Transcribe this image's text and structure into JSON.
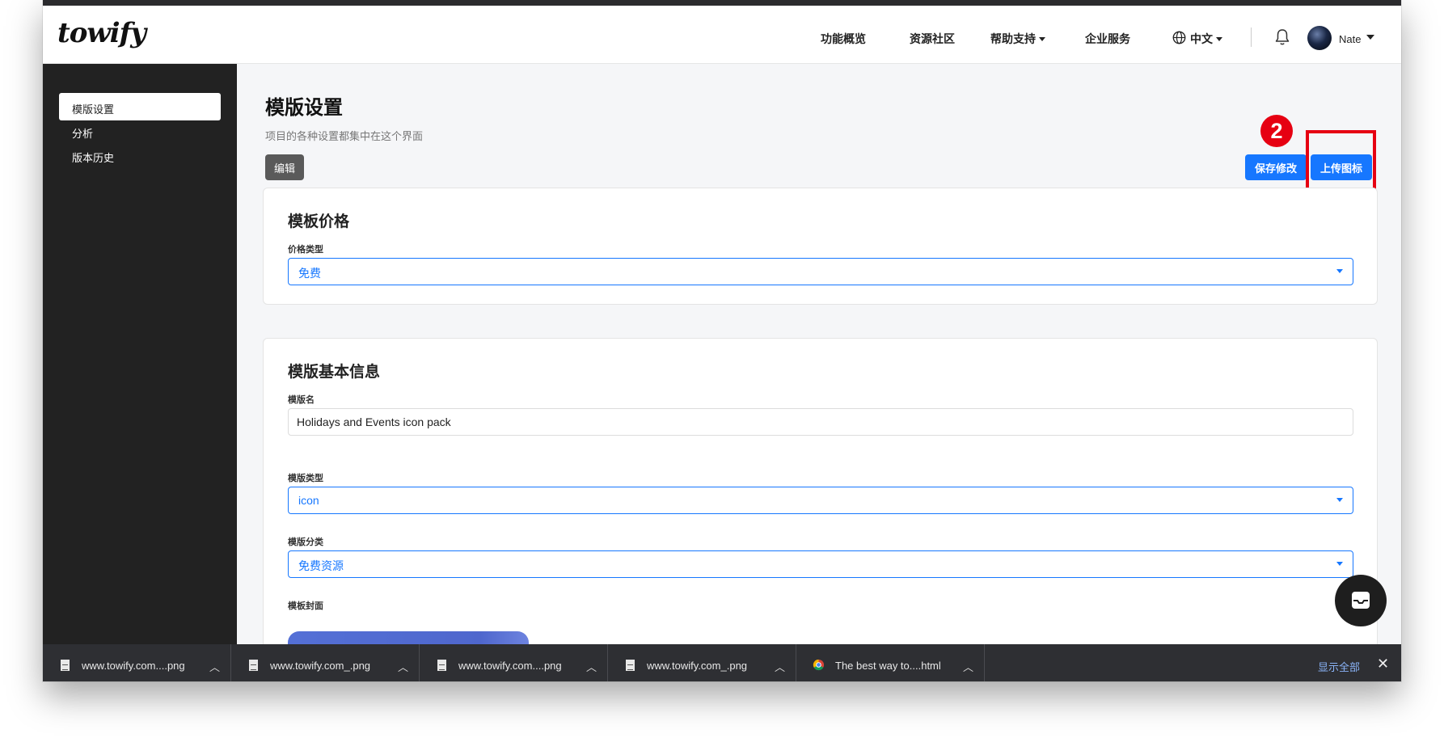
{
  "brand": {
    "logo": "towify"
  },
  "header": {
    "nav": [
      "功能概览",
      "资源社区",
      "帮助支持",
      "企业服务"
    ],
    "language": "中文",
    "user_name": "Nate"
  },
  "sidebar": {
    "items": [
      {
        "label": "模版设置",
        "active": true
      },
      {
        "label": "分析",
        "active": false
      },
      {
        "label": "版本历史",
        "active": false
      }
    ]
  },
  "main": {
    "title": "模版设置",
    "subtitle": "项目的各种设置都集中在这个界面",
    "edit_label": "编辑",
    "save_label": "保存修改",
    "upload_label": "上传图标",
    "step_marker": "2",
    "price_card": {
      "title": "模板价格",
      "price_type_label": "价格类型",
      "price_type_value": "免费"
    },
    "info_card": {
      "title": "模版基本信息",
      "name_label": "模版名",
      "name_value": "Holidays and Events icon pack",
      "type_label": "模版类型",
      "type_value": "icon",
      "category_label": "模版分类",
      "category_value": "免费资源",
      "cover_label": "模板封面"
    }
  },
  "downloads": {
    "items": [
      {
        "name": "www.towify.com....png",
        "icon": "file-icon"
      },
      {
        "name": "www.towify.com_.png",
        "icon": "file-icon"
      },
      {
        "name": "www.towify.com....png",
        "icon": "file-icon"
      },
      {
        "name": "www.towify.com_.png",
        "icon": "file-icon"
      },
      {
        "name": "The best way to....html",
        "icon": "chrome-icon"
      }
    ],
    "show_all": "显示全部",
    "close": "✕"
  },
  "colors": {
    "accent": "#1677ff",
    "sidebar_bg": "#222222",
    "highlight": "#e60012"
  }
}
